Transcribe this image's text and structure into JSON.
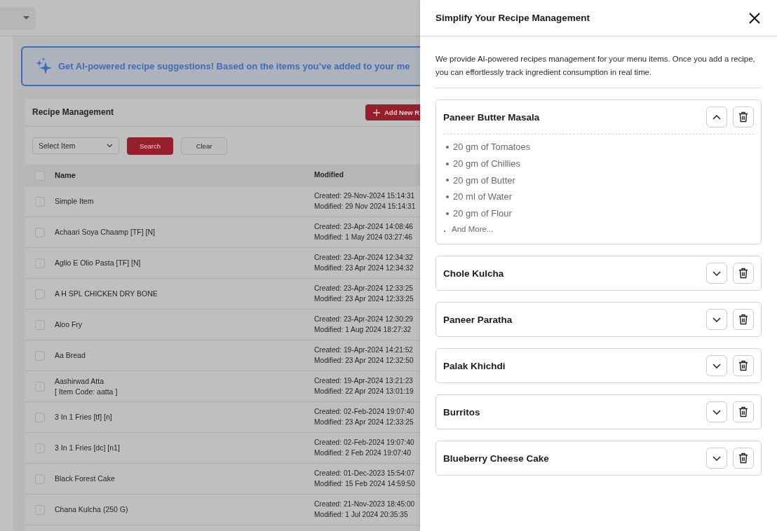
{
  "banner": {
    "text": "Get AI-powered recipe suggestions! Based on the items you’ve added to your me"
  },
  "recipe_management": {
    "title": "Recipe Management",
    "add_button": "Add New R",
    "filter": {
      "select_placeholder": "Select Item",
      "search_button": "Search",
      "clear_button": "Clear"
    },
    "table": {
      "header_checked": false,
      "columns": [
        "Name",
        "Modified"
      ],
      "rows": [
        {
          "checked": false,
          "name": "Simple Item",
          "created": "Created: 29-Nov-2024 15:14:31",
          "modified": "Modified: 29 Nov 2024 15:14:31"
        },
        {
          "checked": false,
          "name": "Achaari Soya Chaamp [TF] [N]",
          "created": "Created: 23-Apr-2024 14:08:46",
          "modified": "Modified: 1 May 2024 03:27:46"
        },
        {
          "checked": false,
          "name": "Aglio E Olio Pasta [TF] [N]",
          "created": "Created: 23-Apr-2024 12:34:32",
          "modified": "Modified: 23 Apr 2024 12:34:32"
        },
        {
          "checked": false,
          "name": "A H SPL CHICKEN DRY BONE",
          "created": "Created: 23-Apr-2024 12:33:25",
          "modified": "Modified: 23 Apr 2024 12:33:25"
        },
        {
          "checked": false,
          "name": "Aloo Fry",
          "created": "Created: 23-Apr-2024 12:30:29",
          "modified": "Modified: 1 Aug 2024 18:27:32"
        },
        {
          "checked": false,
          "name": "Aa Bread",
          "created": "Created: 19-Apr-2024 14:21:52",
          "modified": "Modified: 23 Apr 2024 12:32:50"
        },
        {
          "checked": false,
          "name": "Aashirwad Atta",
          "code": "[ Item Code: aatta ]",
          "created": "Created: 19-Apr-2024 13:21:23",
          "modified": "Modified: 22 Apr 2024 13:01:19"
        },
        {
          "checked": false,
          "name": "3 In 1 Fries [tf] [n]",
          "created": "Created: 02-Feb-2024 19:07:40",
          "modified": "Modified: 23 Apr 2024 12:33:25"
        },
        {
          "checked": false,
          "name": "3 In 1 Fries [dc] [n1]",
          "created": "Created: 02-Feb-2024 19:07:40",
          "modified": "Modified: 2 Feb 2024 19:07:40"
        },
        {
          "checked": false,
          "name": "Black Forest Cake",
          "created": "Created: 01-Dec-2023 15:54:07",
          "modified": "Modified: 15 Feb 2024 14:59:50"
        },
        {
          "checked": false,
          "name": "Chana Kulcha (250 G)",
          "created": "Created: 21-Nov-2023 18:45:00",
          "modified": "Modified: 1 Jul 2024 20:35:35"
        }
      ]
    }
  },
  "drawer": {
    "title": "Simplify Your Recipe Management",
    "description": "We provide AI-powered recipes management for your menu items. Once you add a recipe, you can effortlessly track ingredient consumption in real time.",
    "recipes": [
      {
        "name": "Paneer Butter Masala",
        "expanded": true,
        "ingredients": [
          "20 gm of Tomatoes",
          "20 gm of Chillies",
          "20 gm of Butter",
          "20 ml of Water",
          "20 gm of Flour"
        ],
        "more_label": "And More..."
      },
      {
        "name": "Chole Kulcha",
        "expanded": false
      },
      {
        "name": "Paneer Paratha",
        "expanded": false
      },
      {
        "name": "Palak Khichdi",
        "expanded": false
      },
      {
        "name": "Burritos",
        "expanded": false
      },
      {
        "name": "Blueberry Cheese Cake",
        "expanded": false
      }
    ]
  }
}
